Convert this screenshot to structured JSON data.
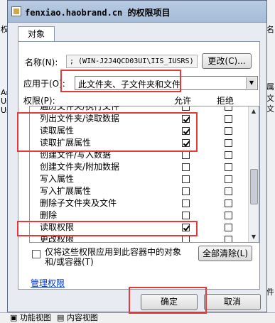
{
  "background": {
    "left_labels": [
      "权限",
      "Am",
      "Us",
      "Us"
    ],
    "right_labels": [
      "名",
      "属",
      "文",
      "文",
      "件"
    ],
    "bottom_tabs": [
      "功能视图",
      "内容视图"
    ]
  },
  "dialog": {
    "title": "fenxiao.haobrand.cn 的权限项目",
    "tab_label": "对象",
    "name_label": "名称(N):",
    "name_value": "; (WIN-J2J4QCD03UI\\IIS_IUSRS)",
    "change_button": "更改(C)...",
    "apply_to_label": "应用于(O):",
    "apply_to_value": "此文件夹、子文件夹和文件",
    "permissions_header": "权限(P):",
    "allow_header": "允许",
    "deny_header": "拒绝",
    "permissions": [
      {
        "label": "遍历文件夹/执行文件",
        "allow": false,
        "deny": false
      },
      {
        "label": "列出文件夹/读取数据",
        "allow": true,
        "deny": false
      },
      {
        "label": "读取属性",
        "allow": true,
        "deny": false
      },
      {
        "label": "读取扩展属性",
        "allow": true,
        "deny": false
      },
      {
        "label": "创建文件/写入数据",
        "allow": false,
        "deny": false
      },
      {
        "label": "创建文件夹/附加数据",
        "allow": false,
        "deny": false
      },
      {
        "label": "写入属性",
        "allow": false,
        "deny": false
      },
      {
        "label": "写入扩展属性",
        "allow": false,
        "deny": false
      },
      {
        "label": "删除子文件夹及文件",
        "allow": false,
        "deny": false
      },
      {
        "label": "删除",
        "allow": false,
        "deny": false
      },
      {
        "label": "读取权限",
        "allow": true,
        "deny": false
      },
      {
        "label": "更改权限",
        "allow": false,
        "deny": false
      }
    ],
    "apply_only_line1": "仅将这些权限应用到此容器中的对象",
    "apply_only_line2": "和/或容器(T)",
    "clear_all_button": "全部清除(L)",
    "manage_link": "管理权限",
    "ok_button": "确定",
    "cancel_button": "取消",
    "highlight_color": "#e23a3a"
  }
}
